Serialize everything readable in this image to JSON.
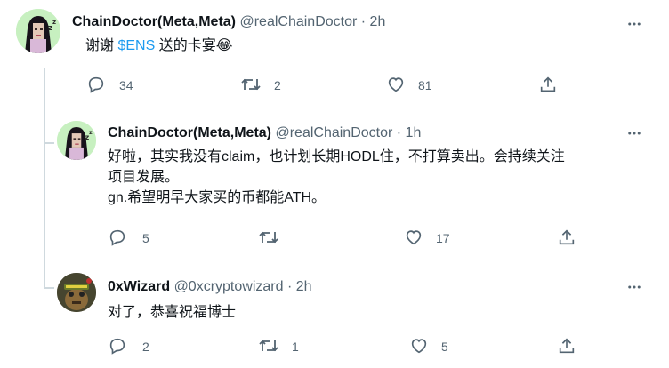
{
  "tweets": [
    {
      "name": "ChainDoctor(Meta,Meta)",
      "handle": "@realChainDoctor",
      "time": "· 2h",
      "text_before": "谢谢 ",
      "cashtag": "$ENS",
      "text_after": " 送的卡宴😂",
      "replies": "34",
      "retweets": "2",
      "likes": "81"
    },
    {
      "name": "ChainDoctor(Meta,Meta)",
      "handle": "@realChainDoctor",
      "time": "· 1h",
      "line1": "好啦，其实我没有claim，也计划长期HODL住，不打算卖出。会持续关注",
      "line2": "项目发展。",
      "line3": "gn.希望明早大家买的币都能ATH。",
      "replies": "5",
      "retweets": "",
      "likes": "17"
    },
    {
      "name": "0xWizard",
      "handle": "@0xcryptowizard",
      "time": "· 2h",
      "text": "对了，恭喜祝福博士",
      "replies": "2",
      "retweets": "1",
      "likes": "5"
    }
  ],
  "icons": {
    "reply": "reply-icon",
    "retweet": "retweet-icon",
    "like": "heart-icon",
    "share": "share-icon",
    "more": "more-icon"
  },
  "colors": {
    "link": "#1d9bf0",
    "secondary": "#536471",
    "line": "#cfd9de"
  }
}
